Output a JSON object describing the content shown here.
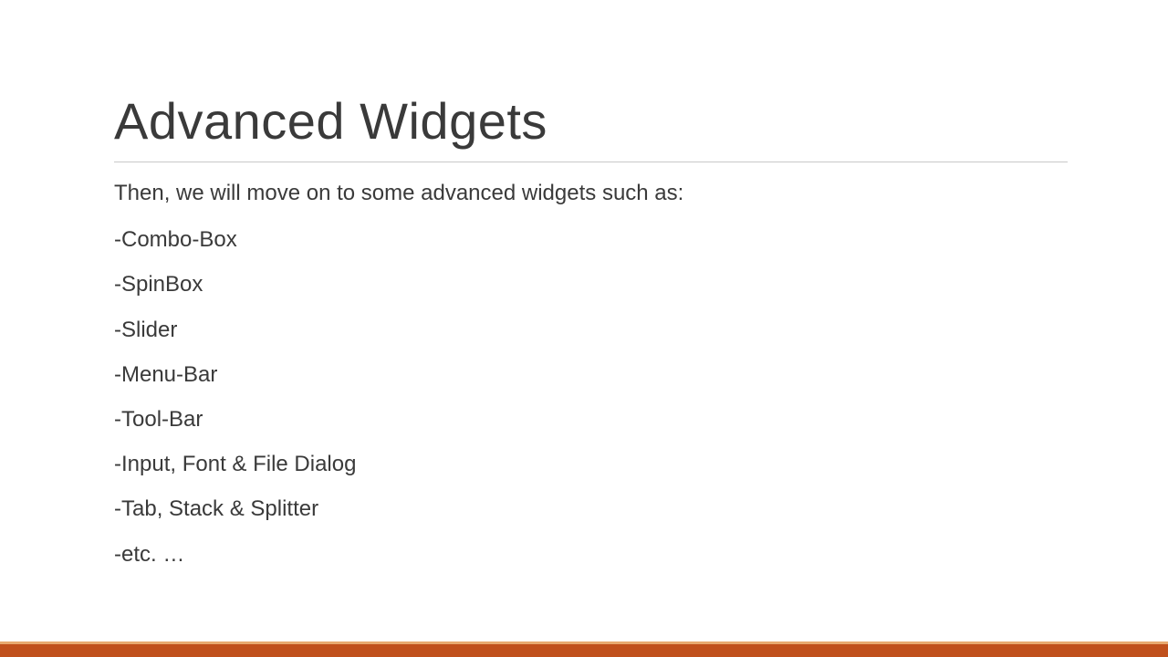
{
  "slide": {
    "title": "Advanced Widgets",
    "intro": "Then, we will move on to some advanced widgets such as:",
    "items": [
      "-Combo-Box",
      "-SpinBox",
      "-Slider",
      "-Menu-Bar",
      "-Tool-Bar",
      "-Input, Font & File Dialog",
      "-Tab, Stack & Splitter",
      "-etc. …"
    ]
  }
}
